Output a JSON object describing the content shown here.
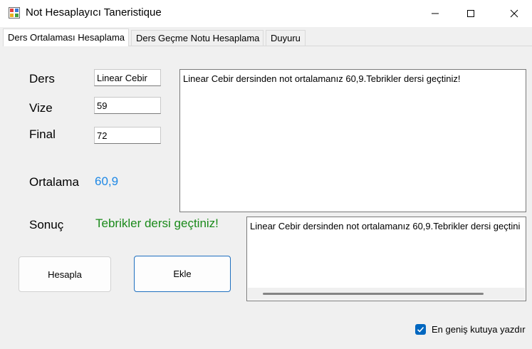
{
  "window": {
    "title": "Not Hesaplayıcı Taneristique",
    "controls": [
      "minimize-icon",
      "maximize-icon",
      "close-icon"
    ]
  },
  "tabs": [
    {
      "label": "Ders Ortalaması Hesaplama",
      "active": true
    },
    {
      "label": "Ders Geçme Notu Hesaplama",
      "active": false
    },
    {
      "label": "Duyuru",
      "active": false
    }
  ],
  "form": {
    "ders_label": "Ders",
    "vize_label": "Vize",
    "final_label": "Final",
    "ortalama_label": "Ortalama",
    "sonuc_label": "Sonuç",
    "ders_value": "Linear Cebir",
    "vize_value": "59",
    "final_value": "72",
    "ortalama_value": "60,9",
    "sonuc_value": "Tebrikler dersi geçtiniz!"
  },
  "buttons": {
    "hesapla": "Hesapla",
    "ekle": "Ekle"
  },
  "output": {
    "textarea_text": "Linear Cebir dersinden not ortalamanız 60,9.Tebrikler dersi geçtiniz!",
    "list_items": [
      "Linear Cebir dersinden not ortalamanız 60,9.Tebrikler dersi geçtini"
    ]
  },
  "checkbox": {
    "label": "En geniş kutuya yazdır",
    "checked": true
  },
  "colors": {
    "accent": "#0067c0",
    "ortalama_color": "#1e88e5",
    "sonuc_color": "#1a8a1a"
  }
}
